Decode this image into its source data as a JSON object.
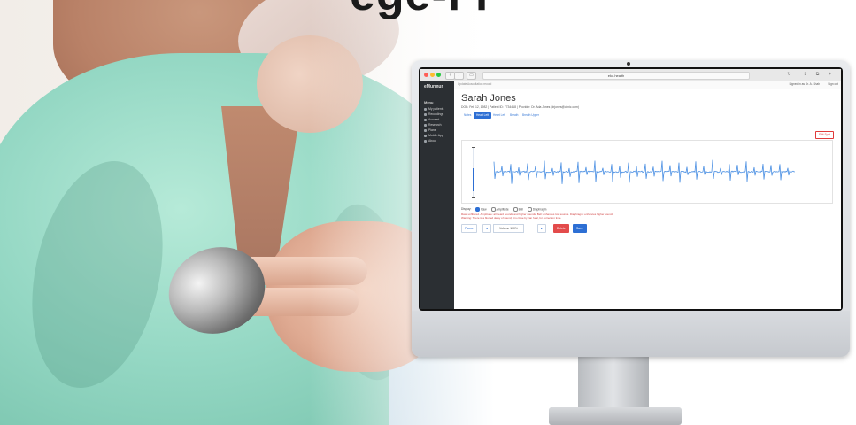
{
  "heading": "ege-l    l",
  "browser": {
    "url": "eko.health"
  },
  "app": {
    "logo": "eMurmur",
    "breadcrumb": "Update Auscultation record",
    "signed_in": "Signed in as Dr. A. Shah",
    "sign_out": "Sign out"
  },
  "sidebar": {
    "menu_label": "Menu",
    "items": [
      {
        "label": "My patients"
      },
      {
        "label": "Recordings"
      },
      {
        "label": "Account"
      },
      {
        "label": "Research"
      },
      {
        "label": "Plans"
      },
      {
        "label": "Mobile App"
      },
      {
        "label": "About"
      }
    ]
  },
  "patient": {
    "name": "Sarah Jones",
    "meta": "DOB: Feb 12, 1982 | Patient ID: 7734418 | Provider: Dr. Ada Jones (drjones@clinic.com)"
  },
  "tabs": [
    "Notes",
    "Heart Left",
    "Heart Left",
    "Breath",
    "Breath Upper"
  ],
  "submit_label": "Edit Spot",
  "display": {
    "label": "Display:",
    "options": [
      {
        "label": "Raw",
        "selected": true
      },
      {
        "label": "Amplitude",
        "selected": false
      },
      {
        "label": "Bell",
        "selected": false
      },
      {
        "label": "Diaphragm",
        "selected": false
      }
    ],
    "description": "Raw: unfiltered. Amplitude: all heard sounds and higher sounds. Bell: enhances low sounds. Diaphragm: enhances higher sounds",
    "warning": "Warning: There is a blurred delay of sound; it is close by can heal, for correction time."
  },
  "controls": {
    "pause": "Pause",
    "volume": "Volume 100%",
    "delete": "Delete",
    "save": "Save"
  },
  "slider": {
    "level": 0.45
  }
}
